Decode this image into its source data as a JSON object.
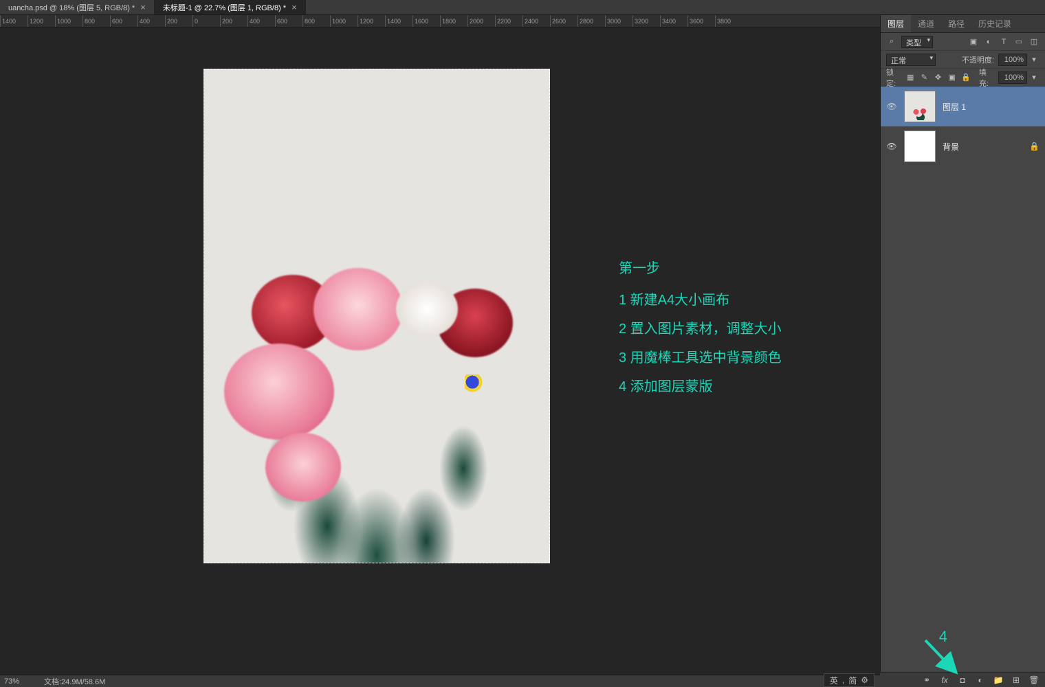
{
  "tabs": [
    {
      "label": "uancha.psd @ 18% (图层 5, RGB/8) *"
    },
    {
      "label": "未标题-1 @ 22.7% (图层 1, RGB/8) *"
    }
  ],
  "ruler_ticks": [
    "1400",
    "1200",
    "1000",
    "800",
    "600",
    "400",
    "200",
    "0",
    "200",
    "400",
    "600",
    "800",
    "1000",
    "1200",
    "1400",
    "1600",
    "1800",
    "2000",
    "2200",
    "2400",
    "2600",
    "2800",
    "3000",
    "3200",
    "3400",
    "3600",
    "3800"
  ],
  "annotation": {
    "title": "第一步",
    "lines": [
      "1 新建A4大小画布",
      "2 置入图片素材，调整大小",
      "3 用魔棒工具选中背景颜色",
      "4 添加图层蒙版"
    ]
  },
  "panel_tabs": [
    "图层",
    "通道",
    "路径",
    "历史记录"
  ],
  "filter": {
    "label": "类型"
  },
  "blend": {
    "mode": "正常",
    "opacity_label": "不透明度:",
    "opacity_value": "100%"
  },
  "lock": {
    "label": "锁定:",
    "fill_label": "填充:",
    "fill_value": "100%"
  },
  "layers": [
    {
      "name": "图层 1",
      "locked": false
    },
    {
      "name": "背景",
      "locked": true
    }
  ],
  "status": {
    "zoom": "73%",
    "doc_label": "文档:",
    "doc_value": "24.9M/58.6M"
  },
  "ime": {
    "lang": "英",
    "mode": "简"
  },
  "callout": "4"
}
